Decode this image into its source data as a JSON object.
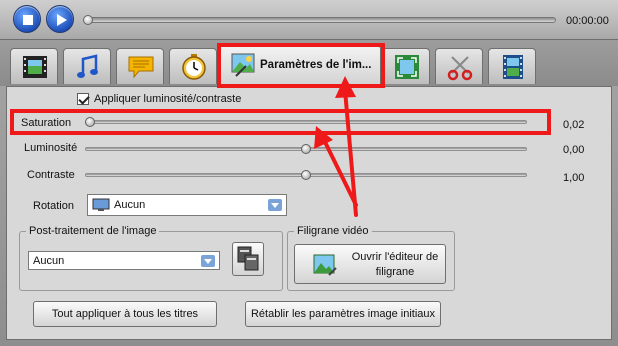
{
  "player": {
    "time": "00:00:00",
    "stop_icon": "stop-icon",
    "play_icon": "play-icon"
  },
  "tabs": [
    {
      "icon": "film-icon"
    },
    {
      "icon": "music-note-icon"
    },
    {
      "icon": "speech-bubble-icon"
    },
    {
      "icon": "stopwatch-icon"
    },
    {
      "icon": "image-settings-icon",
      "label": "Paramètres de l'im..."
    },
    {
      "icon": "crop-frame-icon"
    },
    {
      "icon": "scissors-icon"
    },
    {
      "icon": "film-strip-icon"
    }
  ],
  "panel": {
    "apply_checkbox_label": "Appliquer luminosité/contraste",
    "sliders": [
      {
        "label": "Saturation",
        "value": "0,02",
        "position": 0.01
      },
      {
        "label": "Luminosité",
        "value": "0,00",
        "position": 0.5
      },
      {
        "label": "Contraste",
        "value": "1,00",
        "position": 0.5
      }
    ],
    "rotation": {
      "label": "Rotation",
      "value": "Aucun"
    },
    "post": {
      "title": "Post-traitement de l'image",
      "value": "Aucun"
    },
    "watermark": {
      "title": "Filigrane vidéo",
      "button_line1": "Ouvrir l'éditeur de",
      "button_line2": "filigrane"
    },
    "apply_all_button": "Tout appliquer à tous les titres",
    "reset_button": "Rétablir les paramètres image initiaux"
  },
  "annotation": {
    "color": "#ee1a1a"
  }
}
